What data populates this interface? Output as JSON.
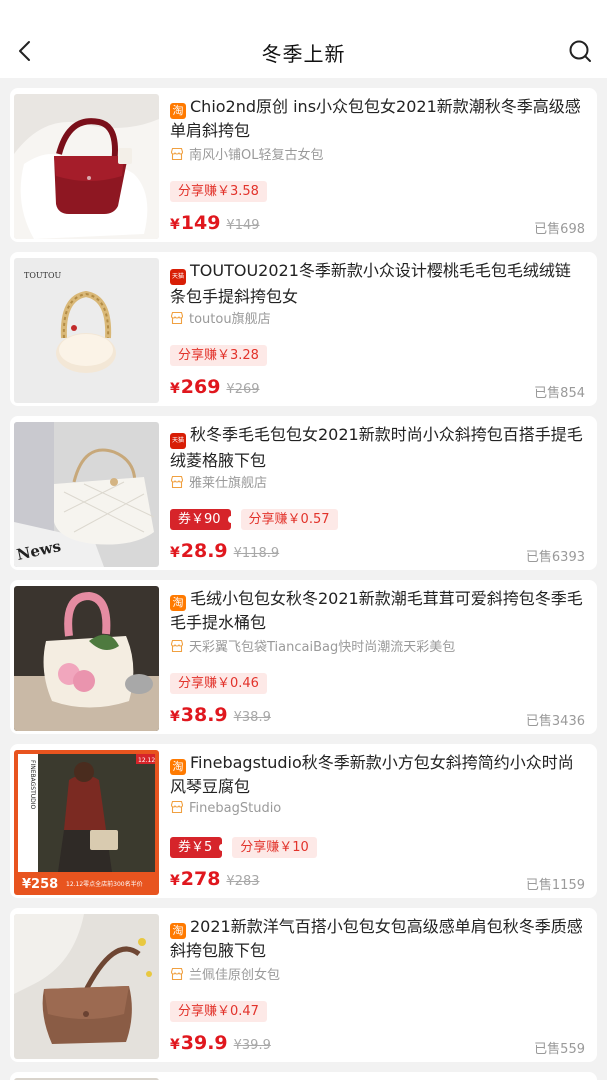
{
  "header": {
    "title": "冬季上新",
    "back_icon": "chevron-left-icon",
    "search_icon": "search-icon"
  },
  "colors": {
    "price_red": "#e0171e",
    "coupon_red": "#d6242a",
    "share_bg": "#fde9e7",
    "taobao_orange": "#ff7a00",
    "tmall_red": "#d81e06"
  },
  "products": [
    {
      "platform": "taobao",
      "platform_glyph": "淘",
      "title": "Chio2nd原创 ins小众包包女2021新款潮秋冬季高级感单肩斜挎包",
      "shop": "南风小铺OL轻复古女包",
      "coupon": "",
      "share": "分享赚￥3.58",
      "yen": "¥",
      "price": "149",
      "original_price": "¥149",
      "sold": "已售698",
      "image": "burgundy shoulder bag on white fur"
    },
    {
      "platform": "tmall",
      "platform_glyph": "天猫",
      "title": "TOUTOU2021冬季新款小众设计樱桃毛毛包毛绒绒链条包手提斜挎包女",
      "shop": "toutou旗舰店",
      "coupon": "",
      "share": "分享赚￥3.28",
      "yen": "¥",
      "price": "269",
      "original_price": "¥269",
      "sold": "已售854",
      "image_brand": "TOUTOU",
      "image": "cream fluffy bag with gold chain"
    },
    {
      "platform": "tmall",
      "platform_glyph": "天猫",
      "title": "秋冬季毛毛包包女2021新款时尚小众斜挎包百搭手提毛绒菱格腋下包",
      "shop": "雅莱仕旗舰店",
      "coupon": "券￥90",
      "share": "分享赚￥0.57",
      "yen": "¥",
      "price": "28.9",
      "original_price": "¥118.9",
      "sold": "已售6393",
      "image_text": "News",
      "image": "white quilted fluffy bag on newspaper"
    },
    {
      "platform": "taobao",
      "platform_glyph": "淘",
      "title": "毛绒小包包女秋冬2021新款潮毛茸茸可爱斜挎包冬季毛毛手提水桶包",
      "shop": "天彩翼飞包袋TiancaiBag快时尚潮流天彩美包",
      "coupon": "",
      "share": "分享赚￥0.46",
      "yen": "¥",
      "price": "38.9",
      "original_price": "¥38.9",
      "sold": "已售3436",
      "image": "fluffy bucket bag with pink pom-poms"
    },
    {
      "platform": "taobao",
      "platform_glyph": "淘",
      "title": "Finebagstudio秋冬季新款小方包女斜挎简约小众时尚风琴豆腐包",
      "shop": "FinebagStudio",
      "coupon": "券￥5",
      "share": "分享赚￥10",
      "yen": "¥",
      "price": "278",
      "original_price": "¥283",
      "sold": "已售1159",
      "image_brand_vertical": "FINEBAGSTUDIO",
      "image_promo_date": "12.12",
      "image_promo_price": "¥258",
      "image_promo_text": "12.12零点全店前300名半价",
      "image": "woman with small beige crossbody bag"
    },
    {
      "platform": "taobao",
      "platform_glyph": "淘",
      "title": "2021新款洋气百搭小包包女包高级感单肩包秋冬季质感斜挎包腋下包",
      "shop": "兰佩佳原创女包",
      "coupon": "",
      "share": "分享赚￥0.47",
      "yen": "¥",
      "price": "39.9",
      "original_price": "¥39.9",
      "sold": "已售559",
      "image": "brown leather flap bag on knit sweater"
    }
  ]
}
